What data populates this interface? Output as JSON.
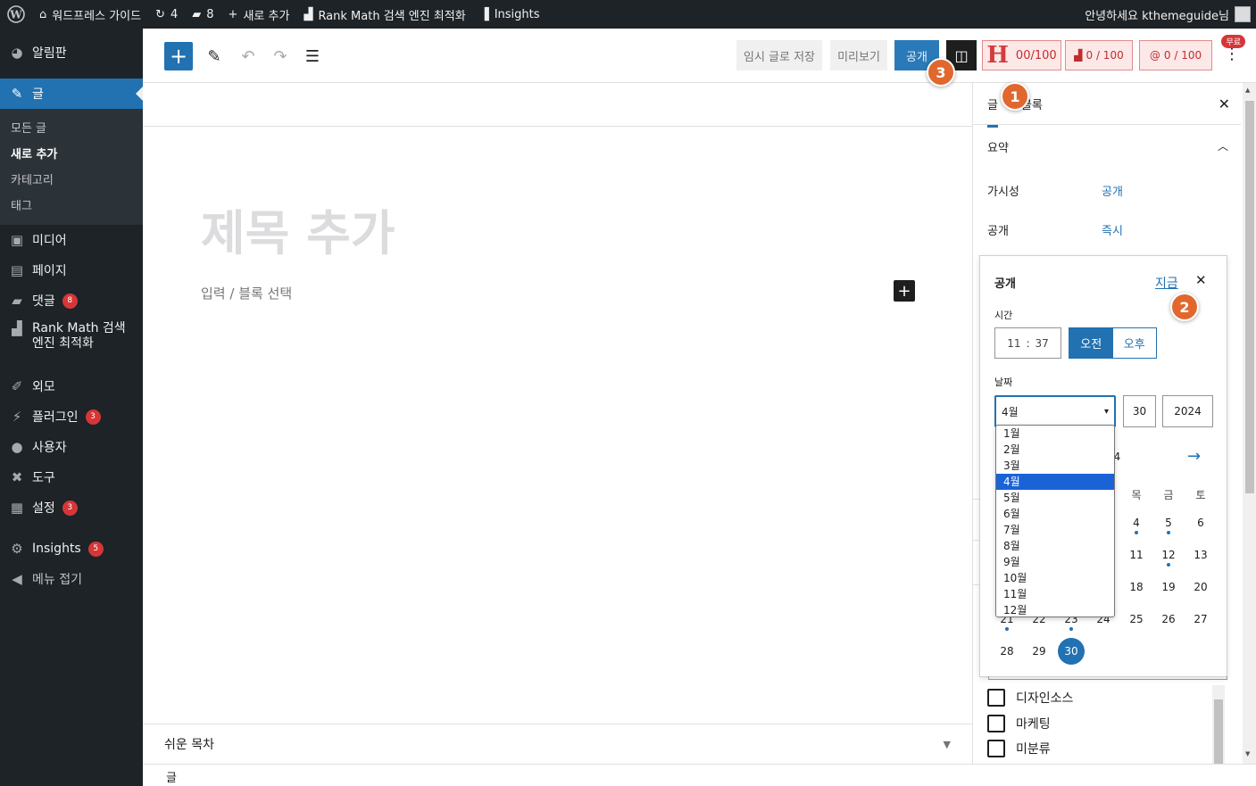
{
  "adminbar": {
    "site_name": "워드프레스 가이드",
    "updates_count": "4",
    "comments_count": "8",
    "new_label": "새로 추가",
    "rankmath_label": "Rank Math 검색 엔진 최적화",
    "insights_label": "Insights",
    "greeting": "안녕하세요 kthemeguide님"
  },
  "sidebar": {
    "dashboard": "알림판",
    "posts": "글",
    "posts_sub": [
      "모든 글",
      "새로 추가",
      "카테고리",
      "태그"
    ],
    "media": "미디어",
    "pages": "페이지",
    "comments": "댓글",
    "comments_badge": "8",
    "rankmath_line1": "Rank Math 검색",
    "rankmath_line2": "엔진 최적화",
    "appearance": "외모",
    "plugins": "플러그인",
    "plugins_badge": "3",
    "users": "사용자",
    "tools": "도구",
    "settings": "설정",
    "settings_badge": "3",
    "insights": "Insights",
    "insights_badge": "5",
    "collapse": "메뉴 접기"
  },
  "header": {
    "inserter_symbol": "+",
    "save_draft": "임시 글로 저장",
    "preview": "미리보기",
    "publish": "공개",
    "h_score": "00/100",
    "rm_score_1": "0 / 100",
    "rm_score_2": "0 / 100",
    "free_tag": "무료"
  },
  "canvas": {
    "title_placeholder": "제목 추가",
    "block_placeholder": "입력 / 블록 선택"
  },
  "toc": {
    "label": "쉬운 목차"
  },
  "footer": {
    "breadcrumb": "글"
  },
  "settings": {
    "tab_post": "글",
    "tab_block": "블록",
    "summary": "요약",
    "visibility_label": "가시성",
    "visibility_value": "공개",
    "publish_label": "공개",
    "publish_value": "즉시"
  },
  "popover": {
    "title": "공개",
    "now": "지금",
    "time_label": "시간",
    "hour": "11",
    "minute": "37",
    "am": "오전",
    "pm": "오후",
    "date_label": "날짜",
    "month": "4월",
    "day": "30",
    "year": "2024",
    "cal_header_fragment": "24",
    "weekdays_visible": [
      "목",
      "금",
      "토"
    ],
    "months": [
      "1월",
      "2월",
      "3월",
      "4월",
      "5월",
      "6월",
      "7월",
      "8월",
      "9월",
      "10월",
      "11월",
      "12월"
    ],
    "selected_month_index": 3
  },
  "categories": [
    "디자인소스",
    "마케팅",
    "미분류"
  ],
  "steps": [
    "1",
    "2",
    "3"
  ],
  "colors": {
    "accent": "#2271b1",
    "admin_dark": "#1d2327",
    "step_marker": "#e0682e",
    "badge_red": "#d63638"
  }
}
